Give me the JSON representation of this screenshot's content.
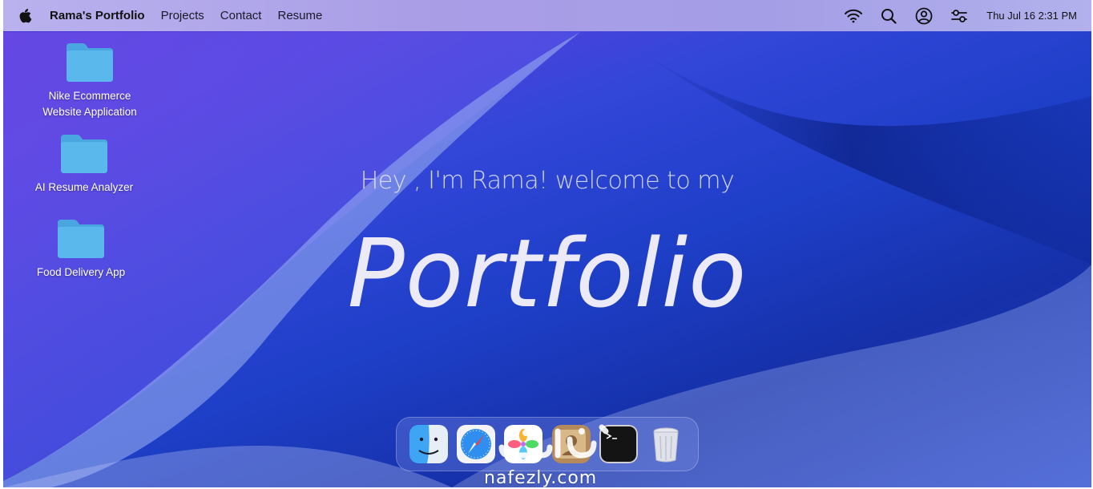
{
  "menubar": {
    "app_name": "Rama's Portfolio",
    "items": [
      {
        "label": "Projects"
      },
      {
        "label": "Contact"
      },
      {
        "label": "Resume"
      }
    ],
    "clock": "Thu Jul 16 2:31 PM",
    "icons": [
      "apple-icon",
      "wifi-icon",
      "search-icon",
      "user-icon",
      "control-center-icon"
    ]
  },
  "desktop": {
    "items": [
      {
        "label_line1": "Nike Ecommerce",
        "label_line2": "Website Application"
      },
      {
        "label_line1": "AI Resume Analyzer"
      },
      {
        "label_line1": "Food Delivery App"
      }
    ]
  },
  "hero": {
    "subtitle": "Hey , I'm Rama! welcome to my",
    "title": "Portfolio"
  },
  "dock": {
    "apps": [
      "finder-icon",
      "safari-icon",
      "photos-icon",
      "contacts-icon",
      "terminal-icon",
      "trash-icon"
    ]
  },
  "watermark": {
    "text": "nafezly.com"
  },
  "colors": {
    "menubar": "#a99de6",
    "folder": "#5ab8ec",
    "background": "#1e3fc8"
  }
}
